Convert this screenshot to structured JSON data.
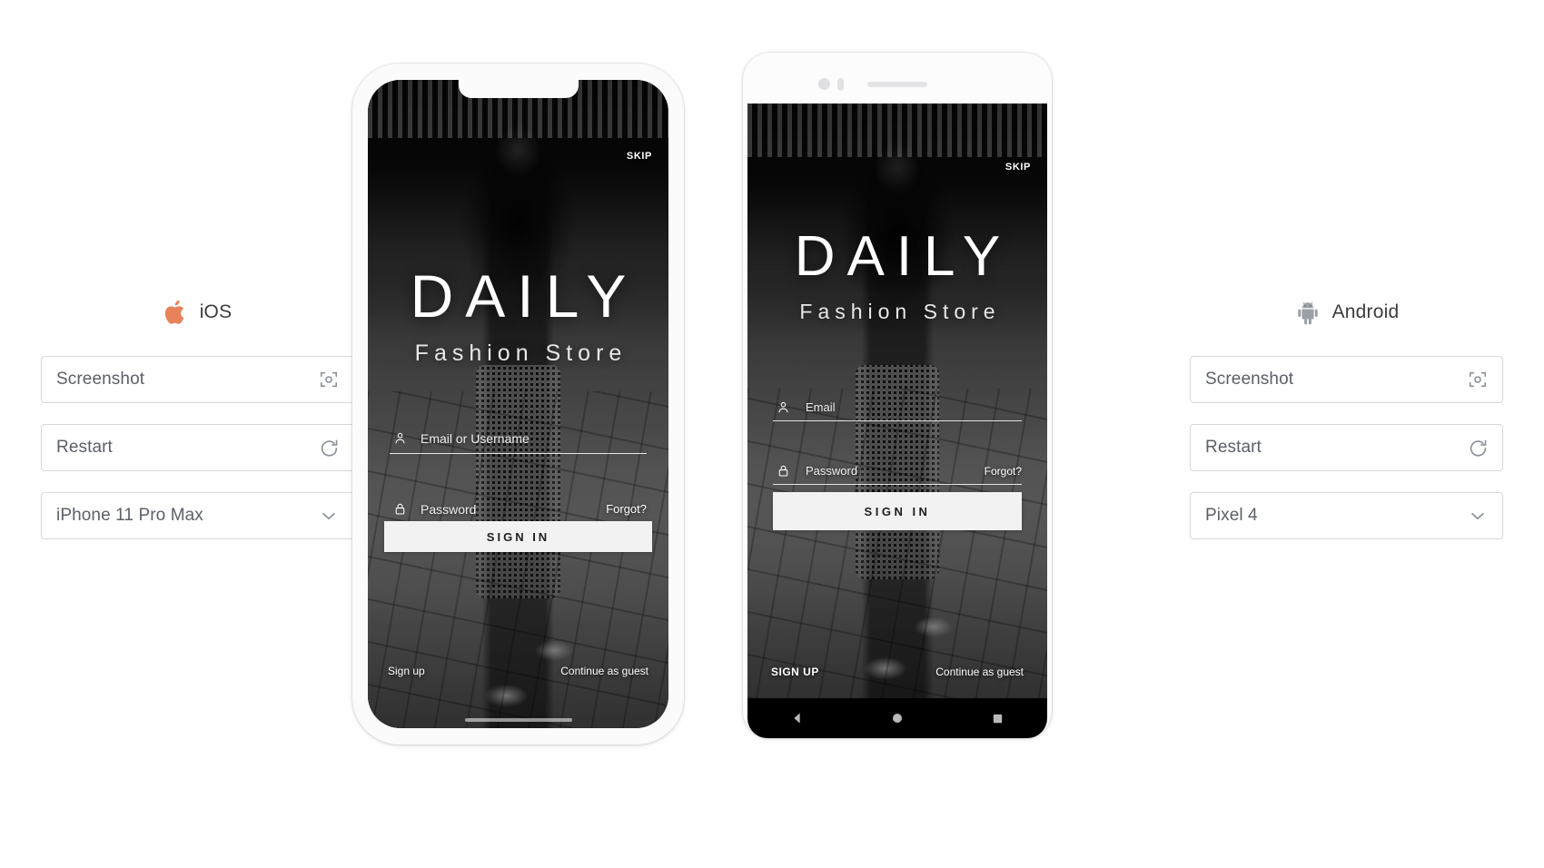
{
  "panels": [
    {
      "os": "iOS",
      "logo_icon": "apple-logo",
      "logo_color": "#e8825a",
      "screenshot_label": "Screenshot",
      "screenshot_icon": "camera-frame-icon",
      "restart_label": "Restart",
      "restart_icon": "refresh-icon",
      "device_label": "iPhone 11 Pro Max",
      "device_icon": "chevron-down-icon"
    },
    {
      "os": "Android",
      "logo_icon": "android-robot-logo",
      "logo_color": "#9aa0a6",
      "screenshot_label": "Screenshot",
      "screenshot_icon": "camera-frame-icon",
      "restart_label": "Restart",
      "restart_icon": "refresh-icon",
      "device_label": "Pixel 4",
      "device_icon": "chevron-down-icon"
    }
  ],
  "app_ios": {
    "skip": "SKIP",
    "brand_title": "DAILY",
    "brand_subtitle": "Fashion Store",
    "email_placeholder": "Email or Username",
    "email_icon": "person-icon",
    "password_placeholder": "Password",
    "password_icon": "lock-icon",
    "forgot_label": "Forgot?",
    "signin_label": "SIGN IN",
    "signup_label": "Sign up",
    "guest_label": "Continue as guest"
  },
  "app_android": {
    "skip": "SKIP",
    "brand_title": "DAILY",
    "brand_subtitle": "Fashion Store",
    "email_placeholder": "Email",
    "email_icon": "person-icon",
    "password_placeholder": "Password",
    "password_icon": "lock-icon",
    "forgot_label": "Forgot?",
    "signin_label": "SIGN IN",
    "signup_label": "SIGN UP",
    "guest_label": "Continue as guest",
    "navbar": {
      "back_icon": "triangle-back-icon",
      "home_icon": "circle-home-icon",
      "recents_icon": "square-recents-icon"
    }
  },
  "colors": {
    "page_background": "#ffffff",
    "control_border": "#d6d8de",
    "control_text": "#5c6067",
    "ios_accent": "#e8825a",
    "android_accent": "#9aa0a6"
  }
}
